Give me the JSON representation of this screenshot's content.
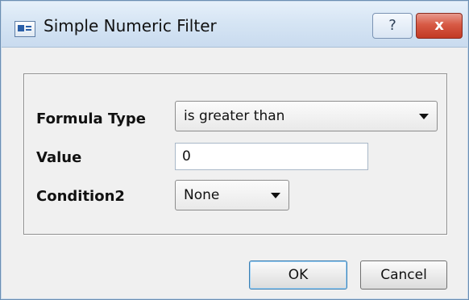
{
  "window": {
    "title": "Simple Numeric Filter",
    "help_label": "?",
    "close_label": "x"
  },
  "form": {
    "formula_type": {
      "label": "Formula Type",
      "selected": "is greater than"
    },
    "value": {
      "label": "Value",
      "text": "0"
    },
    "condition2": {
      "label": "Condition2",
      "selected": "None"
    }
  },
  "buttons": {
    "ok": "OK",
    "cancel": "Cancel"
  }
}
